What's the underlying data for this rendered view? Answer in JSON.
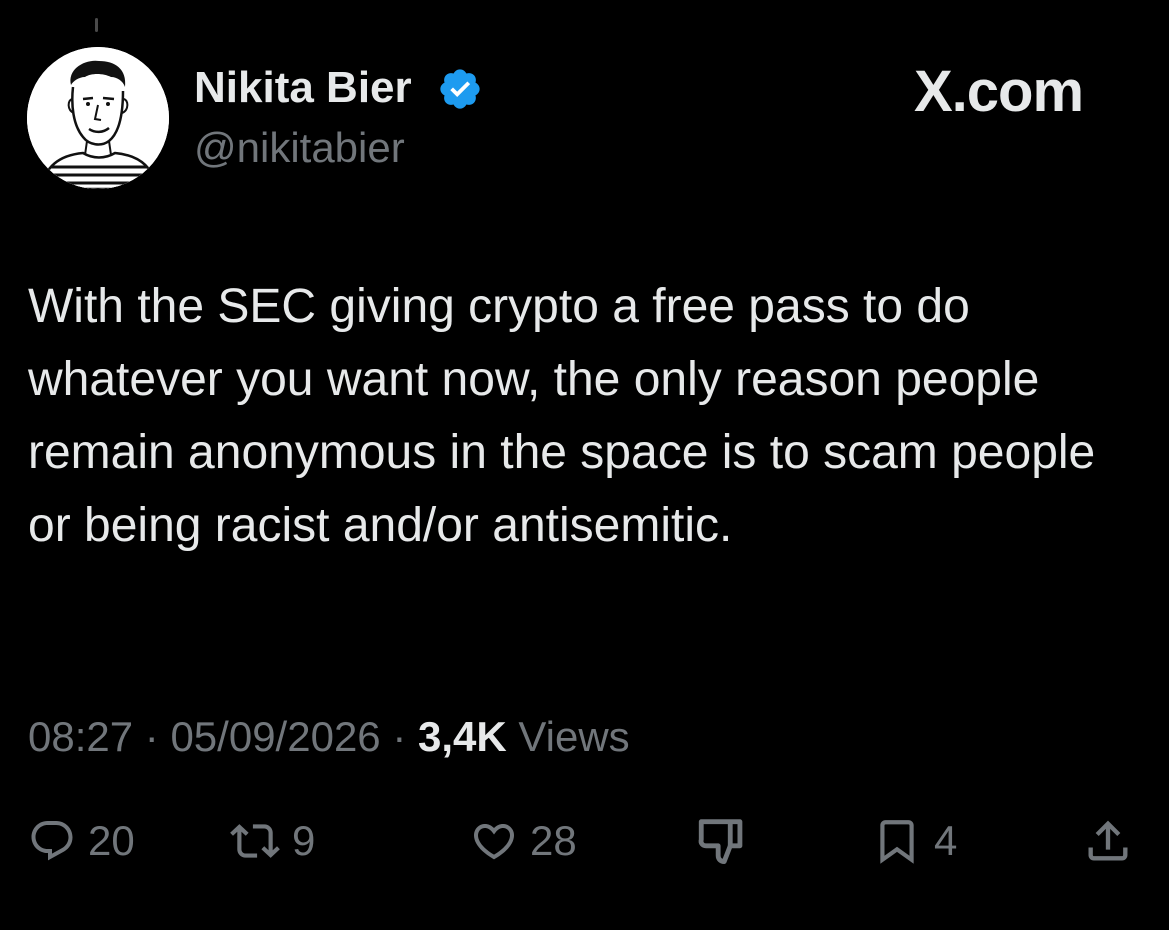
{
  "header": {
    "display_name": "Nikita Bier",
    "handle": "@nikitabier",
    "brand": "X.com",
    "verified": true,
    "verified_color": "#1d9bf0"
  },
  "tweet": {
    "text": "With the SEC giving crypto a free pass to do whatever you want now, the only reason people remain anonymous in the space is to scam people or being racist and/or antisemitic."
  },
  "meta": {
    "time": "08:27",
    "separator": "·",
    "date": "05/09/2026",
    "views_count": "3,4K",
    "views_label": "Views"
  },
  "actions": {
    "reply": {
      "icon": "reply-icon",
      "count": "20"
    },
    "retweet": {
      "icon": "retweet-icon",
      "count": "9"
    },
    "like": {
      "icon": "heart-icon",
      "count": "28"
    },
    "dislike": {
      "icon": "thumbs-down-icon",
      "count": ""
    },
    "bookmark": {
      "icon": "bookmark-icon",
      "count": "4"
    },
    "share": {
      "icon": "share-icon",
      "count": ""
    }
  },
  "colors": {
    "background": "#000000",
    "primary_text": "#e7e9ea",
    "secondary_text": "#71767b"
  }
}
